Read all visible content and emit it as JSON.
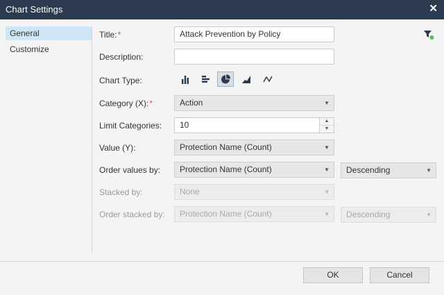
{
  "dialog": {
    "title": "Chart Settings",
    "close_glyph": "✕"
  },
  "sidebar": {
    "items": [
      {
        "label": "General",
        "active": true
      },
      {
        "label": "Customize",
        "active": false
      }
    ]
  },
  "filter_icon": {
    "name": "filter-icon",
    "color": "#2b3a4f",
    "dot_color": "#5cb85c"
  },
  "form": {
    "title_label": "Title:",
    "title_value": "Attack Prevention by Policy",
    "description_label": "Description:",
    "description_value": "",
    "chart_type_label": "Chart Type:",
    "chart_types": [
      {
        "icon": "column-chart-icon",
        "selected": false
      },
      {
        "icon": "bar-chart-icon",
        "selected": false
      },
      {
        "icon": "pie-chart-icon",
        "selected": true
      },
      {
        "icon": "area-chart-icon",
        "selected": false
      },
      {
        "icon": "line-chart-icon",
        "selected": false
      }
    ],
    "category_label": "Category (X):",
    "category_value": "Action",
    "limit_label": "Limit Categories:",
    "limit_value": "10",
    "value_label": "Value (Y):",
    "value_value": "Protection Name (Count)",
    "order_label": "Order values by:",
    "order_value": "Protection Name (Count)",
    "order_dir": "Descending",
    "stacked_label": "Stacked by:",
    "stacked_value": "None",
    "order_stacked_label": "Order stacked by:",
    "order_stacked_value": "Protection Name (Count)",
    "order_stacked_dir": "Descending",
    "required_mark": "*",
    "dropdown_arrow": "▼",
    "spin_up": "▲",
    "spin_down": "▼"
  },
  "buttons": {
    "ok": "OK",
    "cancel": "Cancel"
  },
  "colors": {
    "titlebar": "#2b3a4f",
    "icon": "#2b3a4f",
    "selection": "#cfe6f7",
    "required": "#d9534f"
  }
}
